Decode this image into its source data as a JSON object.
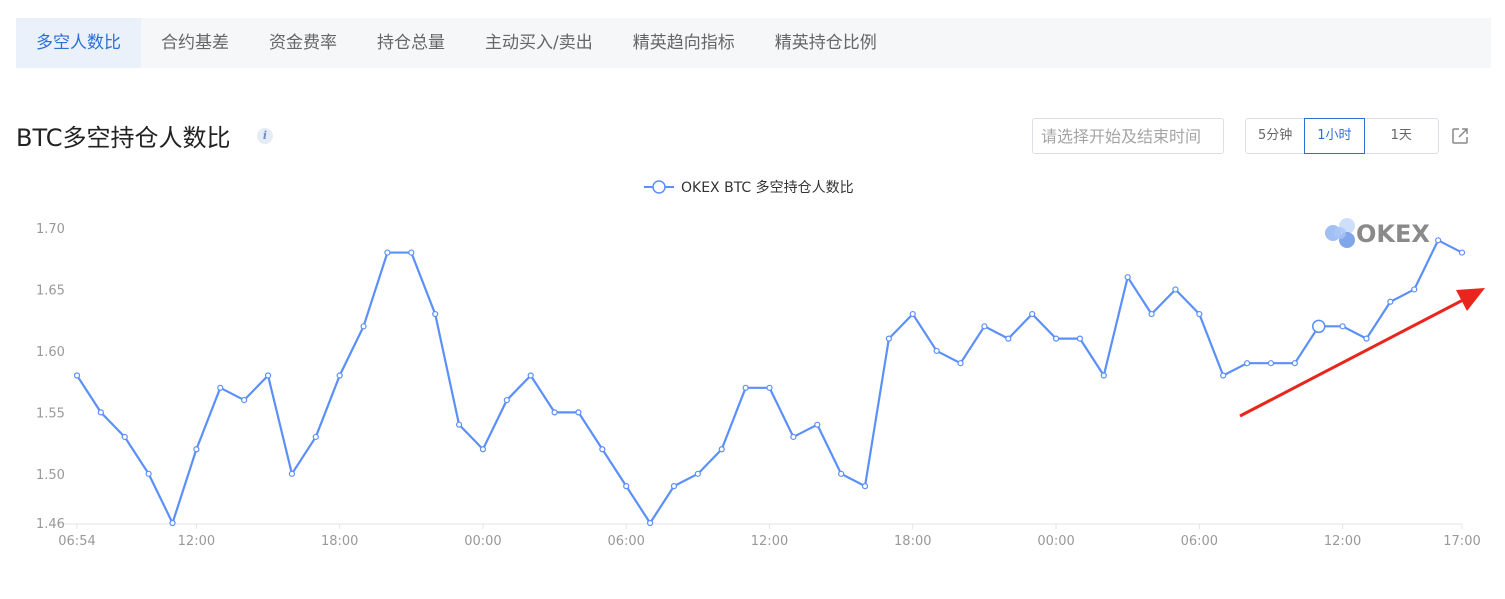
{
  "tabs": [
    {
      "label": "多空人数比",
      "active": true
    },
    {
      "label": "合约基差",
      "active": false
    },
    {
      "label": "资金费率",
      "active": false
    },
    {
      "label": "持仓总量",
      "active": false
    },
    {
      "label": "主动买入/卖出",
      "active": false
    },
    {
      "label": "精英趋向指标",
      "active": false
    },
    {
      "label": "精英持仓比例",
      "active": false
    }
  ],
  "header": {
    "title": "BTC多空持仓人数比",
    "info_icon": "info-icon",
    "date_placeholder": "请选择开始及结束时间",
    "ranges": [
      {
        "label": "5分钟",
        "active": false
      },
      {
        "label": "1小时",
        "active": true
      },
      {
        "label": "1天",
        "active": false
      }
    ],
    "export_icon": "export-icon"
  },
  "chart_data": {
    "type": "line",
    "legend": "OKEX BTC 多空持仓人数比",
    "watermark": "OKEX",
    "x_tick_labels": [
      "06:54",
      "12:00",
      "18:00",
      "00:00",
      "06:00",
      "12:00",
      "18:00",
      "00:00",
      "06:00",
      "12:00",
      "17:00"
    ],
    "ylim": [
      1.46,
      1.7
    ],
    "y_tick_labels": [
      "1.70",
      "1.65",
      "1.60",
      "1.55",
      "1.50",
      "1.46"
    ],
    "series": [
      {
        "name": "OKEX BTC 多空持仓人数比",
        "color": "#5b8ff9",
        "values": [
          1.58,
          1.55,
          1.53,
          1.5,
          1.46,
          1.52,
          1.57,
          1.56,
          1.58,
          1.5,
          1.53,
          1.58,
          1.62,
          1.68,
          1.68,
          1.63,
          1.54,
          1.52,
          1.56,
          1.58,
          1.55,
          1.55,
          1.52,
          1.49,
          1.46,
          1.49,
          1.5,
          1.52,
          1.57,
          1.57,
          1.53,
          1.54,
          1.5,
          1.49,
          1.61,
          1.63,
          1.6,
          1.59,
          1.62,
          1.61,
          1.63,
          1.61,
          1.61,
          1.58,
          1.66,
          1.63,
          1.65,
          1.63,
          1.58,
          1.59,
          1.59,
          1.59,
          1.62,
          1.62,
          1.61,
          1.64,
          1.65,
          1.69,
          1.68
        ]
      }
    ],
    "highlight_index": 52,
    "grid": false,
    "annotation_arrow_color": "#e8261c"
  }
}
